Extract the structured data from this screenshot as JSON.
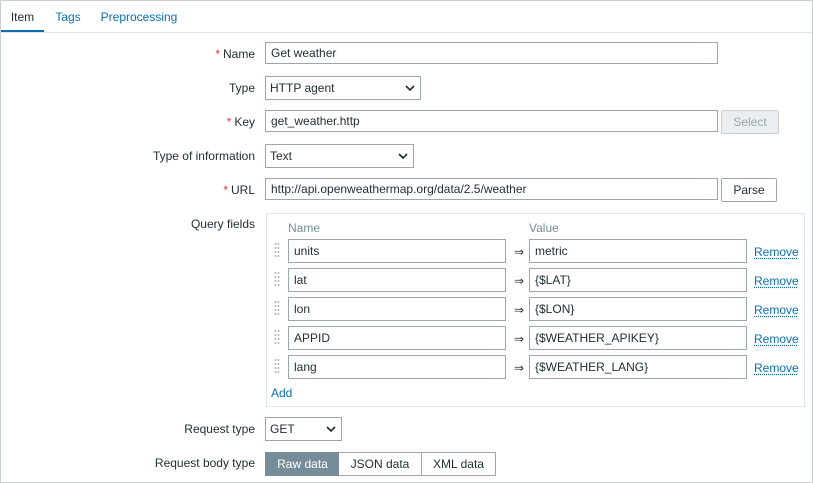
{
  "tabs": [
    {
      "label": "Item",
      "active": true
    },
    {
      "label": "Tags",
      "active": false
    },
    {
      "label": "Preprocessing",
      "active": false
    }
  ],
  "form": {
    "required_marker": "*",
    "name": {
      "label": "Name",
      "value": "Get weather"
    },
    "type": {
      "label": "Type",
      "value": "HTTP agent"
    },
    "key": {
      "label": "Key",
      "value": "get_weather.http",
      "select_label": "Select"
    },
    "type_of_information": {
      "label": "Type of information",
      "value": "Text"
    },
    "url": {
      "label": "URL",
      "value": "http://api.openweathermap.org/data/2.5/weather",
      "parse_label": "Parse"
    },
    "query_fields": {
      "label": "Query fields",
      "col_name": "Name",
      "col_value": "Value",
      "arrow": "⇒",
      "remove_label": "Remove",
      "add_label": "Add",
      "rows": [
        {
          "name": "units",
          "value": "metric"
        },
        {
          "name": "lat",
          "value": "{$LAT}"
        },
        {
          "name": "lon",
          "value": "{$LON}"
        },
        {
          "name": "APPID",
          "value": "{$WEATHER_APIKEY}"
        },
        {
          "name": "lang",
          "value": "{$WEATHER_LANG}"
        }
      ]
    },
    "request_type": {
      "label": "Request type",
      "value": "GET"
    },
    "request_body_type": {
      "label": "Request body type",
      "options": [
        "Raw data",
        "JSON data",
        "XML data"
      ],
      "selected": "Raw data"
    }
  },
  "colors": {
    "link": "#0a6fb0",
    "required": "#e33734",
    "active_segment": "#768d99"
  }
}
